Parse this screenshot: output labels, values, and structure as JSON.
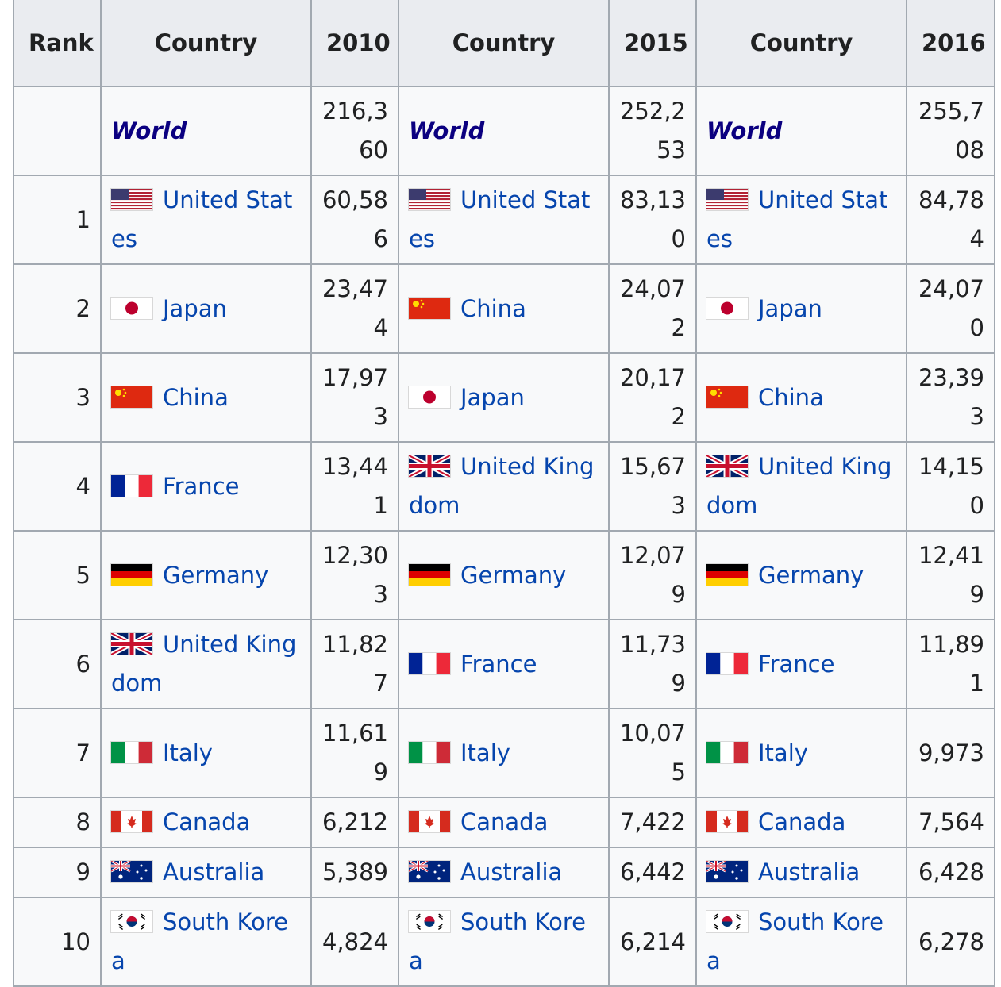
{
  "headers": {
    "rank": "Rank",
    "country": "Country",
    "years": [
      "2010",
      "2015",
      "2016"
    ]
  },
  "rows": [
    {
      "rank": "",
      "cells": [
        {
          "country": "World",
          "flag": "",
          "value": "216,360"
        },
        {
          "country": "World",
          "flag": "",
          "value": "252,253"
        },
        {
          "country": "World",
          "flag": "",
          "value": "255,708"
        }
      ]
    },
    {
      "rank": "1",
      "cells": [
        {
          "country": "United States",
          "flag": "us-flag-icon",
          "value": "60,586"
        },
        {
          "country": "United States",
          "flag": "us-flag-icon",
          "value": "83,130"
        },
        {
          "country": "United States",
          "flag": "us-flag-icon",
          "value": "84,784"
        }
      ]
    },
    {
      "rank": "2",
      "cells": [
        {
          "country": "Japan",
          "flag": "jp-flag-icon",
          "value": "23,474"
        },
        {
          "country": "China",
          "flag": "cn-flag-icon",
          "value": "24,072"
        },
        {
          "country": "Japan",
          "flag": "jp-flag-icon",
          "value": "24,070"
        }
      ]
    },
    {
      "rank": "3",
      "cells": [
        {
          "country": "China",
          "flag": "cn-flag-icon",
          "value": "17,973"
        },
        {
          "country": "Japan",
          "flag": "jp-flag-icon",
          "value": "20,172"
        },
        {
          "country": "China",
          "flag": "cn-flag-icon",
          "value": "23,393"
        }
      ]
    },
    {
      "rank": "4",
      "cells": [
        {
          "country": "France",
          "flag": "fr-flag-icon",
          "value": "13,441"
        },
        {
          "country": "United Kingdom",
          "flag": "uk-flag-icon",
          "value": "15,673"
        },
        {
          "country": "United Kingdom",
          "flag": "uk-flag-icon",
          "value": "14,150"
        }
      ]
    },
    {
      "rank": "5",
      "cells": [
        {
          "country": "Germany",
          "flag": "de-flag-icon",
          "value": "12,303"
        },
        {
          "country": "Germany",
          "flag": "de-flag-icon",
          "value": "12,079"
        },
        {
          "country": "Germany",
          "flag": "de-flag-icon",
          "value": "12,419"
        }
      ]
    },
    {
      "rank": "6",
      "cells": [
        {
          "country": "United Kingdom",
          "flag": "uk-flag-icon",
          "value": "11,827"
        },
        {
          "country": "France",
          "flag": "fr-flag-icon",
          "value": "11,739"
        },
        {
          "country": "France",
          "flag": "fr-flag-icon",
          "value": "11,891"
        }
      ]
    },
    {
      "rank": "7",
      "cells": [
        {
          "country": "Italy",
          "flag": "it-flag-icon",
          "value": "11,619"
        },
        {
          "country": "Italy",
          "flag": "it-flag-icon",
          "value": "10,075"
        },
        {
          "country": "Italy",
          "flag": "it-flag-icon",
          "value": "9,973"
        }
      ]
    },
    {
      "rank": "8",
      "cells": [
        {
          "country": "Canada",
          "flag": "ca-flag-icon",
          "value": "6,212"
        },
        {
          "country": "Canada",
          "flag": "ca-flag-icon",
          "value": "7,422"
        },
        {
          "country": "Canada",
          "flag": "ca-flag-icon",
          "value": "7,564"
        }
      ]
    },
    {
      "rank": "9",
      "cells": [
        {
          "country": "Australia",
          "flag": "au-flag-icon",
          "value": "5,389"
        },
        {
          "country": "Australia",
          "flag": "au-flag-icon",
          "value": "6,442"
        },
        {
          "country": "Australia",
          "flag": "au-flag-icon",
          "value": "6,428"
        }
      ]
    },
    {
      "rank": "10",
      "cells": [
        {
          "country": "South Korea",
          "flag": "kr-flag-icon",
          "value": "4,824"
        },
        {
          "country": "South Korea",
          "flag": "kr-flag-icon",
          "value": "6,214"
        },
        {
          "country": "South Korea",
          "flag": "kr-flag-icon",
          "value": "6,278"
        }
      ]
    }
  ],
  "colors": {
    "header_bg": "#eaecf0",
    "cell_bg": "#f8f9fa",
    "border": "#a2a9b1",
    "link": "#0645ad",
    "world_link": "#0b0080"
  }
}
